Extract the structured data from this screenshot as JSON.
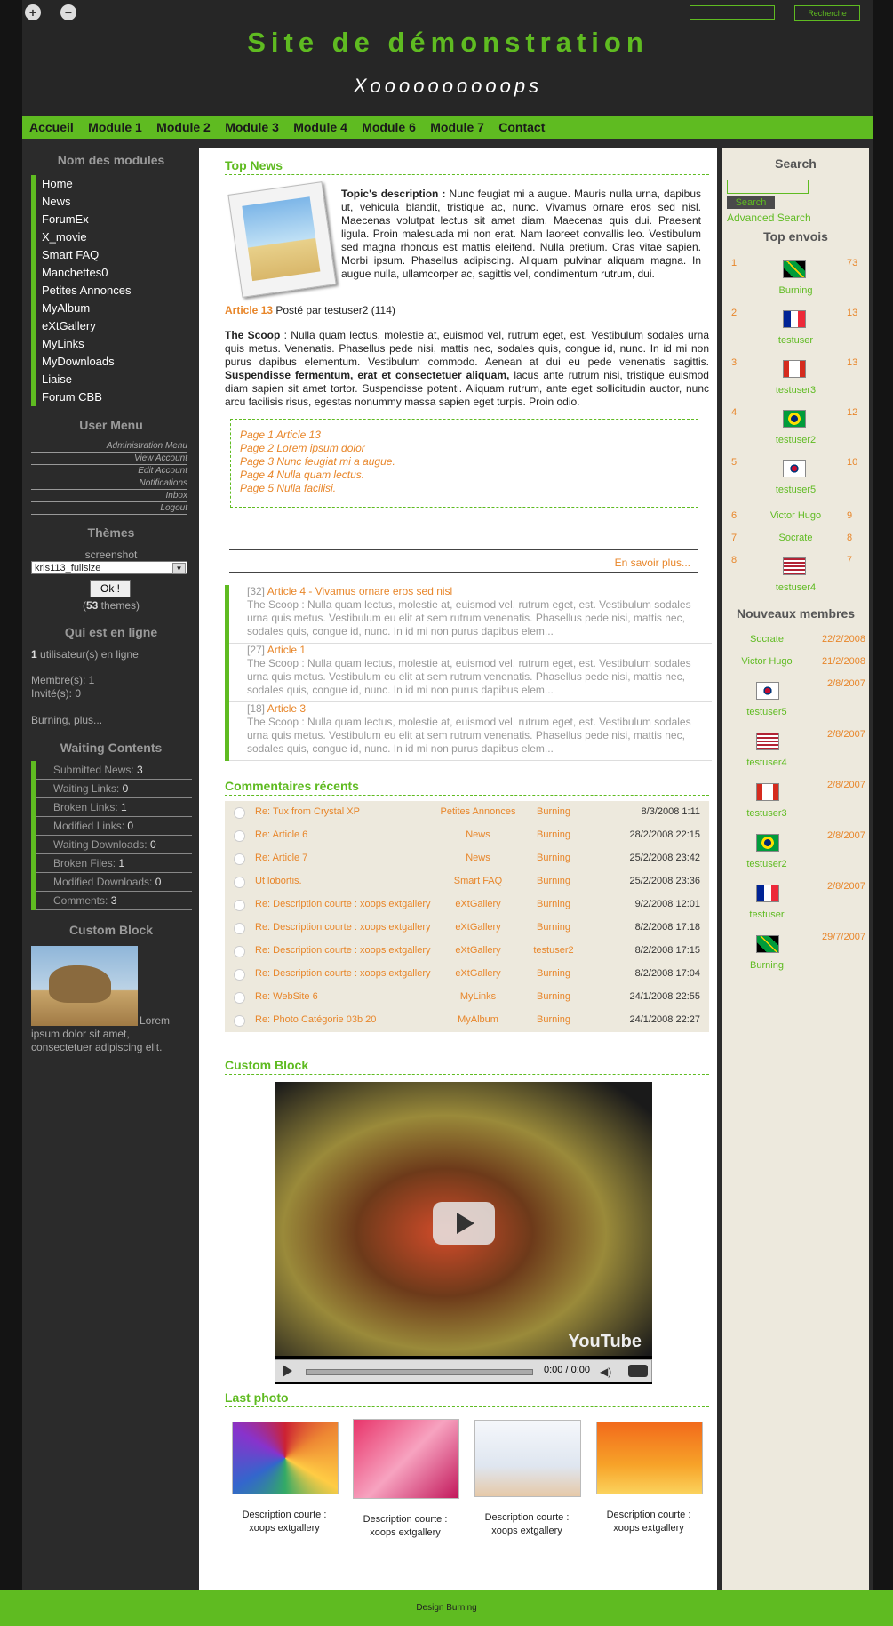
{
  "header": {
    "title": "Site de démonstration",
    "slogan": "Xoooooooooops",
    "search_button": "Recherche"
  },
  "nav": [
    "Accueil",
    "Module 1",
    "Module 2",
    "Module 3",
    "Module 4",
    "Module 6",
    "Module 7",
    "Contact"
  ],
  "left": {
    "modules_title": "Nom des modules",
    "modules": [
      "Home",
      "News",
      "ForumEx",
      "X_movie",
      "Smart FAQ",
      "Manchettes0",
      "Petites Annonces",
      "MyAlbum",
      "eXtGallery",
      "MyLinks",
      "MyDownloads",
      "Liaise",
      "Forum CBB"
    ],
    "user_menu_title": "User Menu",
    "user_menu": [
      "Administration Menu",
      "View Account",
      "Edit Account",
      "Notifications",
      "Inbox",
      "Logout"
    ],
    "themes_title": "Thèmes",
    "themes_label": "screenshot",
    "themes_selected": "kris113_fullsize",
    "themes_button": "Ok !",
    "themes_count": "53",
    "themes_suffix": "themes)",
    "online_title": "Qui est en ligne",
    "online_count": "1",
    "online_text": "utilisateur(s) en ligne",
    "members": "Membre(s): 1",
    "guests": "Invité(s): 0",
    "online_users": "Burning, plus...",
    "waiting_title": "Waiting Contents",
    "waiting": [
      {
        "label": "Submitted News:",
        "value": "3"
      },
      {
        "label": "Waiting Links:",
        "value": "0"
      },
      {
        "label": "Broken Links:",
        "value": "1"
      },
      {
        "label": "Modified Links:",
        "value": "0"
      },
      {
        "label": "Waiting Downloads:",
        "value": "0"
      },
      {
        "label": "Broken Files:",
        "value": "1"
      },
      {
        "label": "Modified Downloads:",
        "value": "0"
      },
      {
        "label": "Comments:",
        "value": "3"
      }
    ],
    "custom_title": "Custom Block",
    "custom_text": "Lorem ipsum dolor sit amet, consectetuer adipiscing elit."
  },
  "main": {
    "top_news_title": "Top News",
    "topic_label": "Topic's description :",
    "topic_text": "Nunc feugiat mi a augue. Mauris nulla urna, dapibus ut, vehicula blandit, tristique ac, nunc. Vivamus ornare eros sed nisl. Maecenas volutpat lectus sit amet diam. Maecenas quis dui. Praesent ligula. Proin malesuada mi non erat. Nam laoreet convallis leo. Vestibulum sed magna rhoncus est mattis eleifend. Nulla pretium. Cras vitae sapien. Morbi ipsum. Phasellus adipiscing. Aliquam pulvinar aliquam magna. In augue nulla, ullamcorper ac, sagittis vel, condimentum rutrum, dui.",
    "article_link": "Article 13",
    "article_meta": "Posté par testuser2 (114)",
    "scoop_label": "The Scoop",
    "scoop_text": ": Nulla quam lectus, molestie at, euismod vel, rutrum eget, est. Vestibulum sodales urna quis metus. Venenatis. Phasellus pede nisi, mattis nec, sodales quis, congue id, nunc. In id mi non purus dapibus elementum. Vestibulum commodo. Aenean at dui eu pede venenatis sagittis.",
    "scoop_bold": "Suspendisse fermentum, erat et consectetuer aliquam,",
    "scoop_text2": "lacus ante rutrum nisi, tristique euismod diam sapien sit amet tortor. Suspendisse potenti. Aliquam rutrum, ante eget sollicitudin auctor, nunc arcu facilisis risus, egestas nonummy massa sapien eget turpis. Proin odio.",
    "pages": [
      "Page 1 Article 13",
      "Page 2 Lorem ipsum dolor",
      "Page 3 Nunc feugiat mi a augue.",
      "Page 4 Nulla quam lectus.",
      "Page 5 Nulla facilisi."
    ],
    "more": "En savoir plus...",
    "related": [
      {
        "id": "[32]",
        "title": "Article 4 - Vivamus ornare eros sed nisl",
        "text": "The Scoop : Nulla quam lectus, molestie at, euismod vel, rutrum eget, est. Vestibulum sodales urna quis metus. Vestibulum eu elit at sem rutrum venenatis. Phasellus pede nisi, mattis nec, sodales quis, congue id, nunc. In id mi non purus dapibus elem..."
      },
      {
        "id": "[27]",
        "title": "Article 1",
        "text": "The Scoop : Nulla quam lectus, molestie at, euismod vel, rutrum eget, est. Vestibulum sodales urna quis metus. Vestibulum eu elit at sem rutrum venenatis. Phasellus pede nisi, mattis nec, sodales quis, congue id, nunc. In id mi non purus dapibus elem..."
      },
      {
        "id": "[18]",
        "title": "Article 3",
        "text": "The Scoop : Nulla quam lectus, molestie at, euismod vel, rutrum eget, est. Vestibulum sodales urna quis metus. Vestibulum eu elit at sem rutrum venenatis. Phasellus pede nisi, mattis nec, sodales quis, congue id, nunc. In id mi non purus dapibus elem..."
      }
    ],
    "comments_title": "Commentaires récents",
    "comments": [
      {
        "title": "Re: Tux from Crystal XP",
        "module": "Petites Annonces",
        "user": "Burning",
        "date": "8/3/2008 1:11"
      },
      {
        "title": "Re: Article 6",
        "module": "News",
        "user": "Burning",
        "date": "28/2/2008 22:15"
      },
      {
        "title": "Re: Article 7",
        "module": "News",
        "user": "Burning",
        "date": "25/2/2008 23:42"
      },
      {
        "title": "Ut lobortis.",
        "module": "Smart FAQ",
        "user": "Burning",
        "date": "25/2/2008 23:36"
      },
      {
        "title": "Re: Description courte : xoops extgallery",
        "module": "eXtGallery",
        "user": "Burning",
        "date": "9/2/2008 12:01"
      },
      {
        "title": "Re: Description courte : xoops extgallery",
        "module": "eXtGallery",
        "user": "Burning",
        "date": "8/2/2008 17:18"
      },
      {
        "title": "Re: Description courte : xoops extgallery",
        "module": "eXtGallery",
        "user": "testuser2",
        "date": "8/2/2008 17:15"
      },
      {
        "title": "Re: Description courte : xoops extgallery",
        "module": "eXtGallery",
        "user": "Burning",
        "date": "8/2/2008 17:04"
      },
      {
        "title": "Re: WebSite 6",
        "module": "MyLinks",
        "user": "Burning",
        "date": "24/1/2008 22:55"
      },
      {
        "title": "Re: Photo Catégorie 03b 20",
        "module": "MyAlbum",
        "user": "Burning",
        "date": "24/1/2008 22:27"
      }
    ],
    "custom_title": "Custom Block",
    "video_time": "0:00 / 0:00",
    "video_brand": "YouTube",
    "last_photo_title": "Last photo",
    "photos": [
      {
        "l1": "Description courte :",
        "l2": "xoops extgallery"
      },
      {
        "l1": "Description courte :",
        "l2": "xoops extgallery"
      },
      {
        "l1": "Description courte :",
        "l2": "xoops extgallery"
      },
      {
        "l1": "Description courte :",
        "l2": "xoops extgallery"
      }
    ]
  },
  "right": {
    "search_title": "Search",
    "search_button": "Search",
    "advanced": "Advanced Search",
    "top_title": "Top envois",
    "top": [
      {
        "rank": "1",
        "name": "Burning",
        "count": "73",
        "flag": "jamaica"
      },
      {
        "rank": "2",
        "name": "testuser",
        "count": "13",
        "flag": "france"
      },
      {
        "rank": "3",
        "name": "testuser3",
        "count": "13",
        "flag": "canada"
      },
      {
        "rank": "4",
        "name": "testuser2",
        "count": "12",
        "flag": "brazil"
      },
      {
        "rank": "5",
        "name": "testuser5",
        "count": "10",
        "flag": "korea"
      },
      {
        "rank": "6",
        "name": "Victor Hugo",
        "count": "9",
        "flag": ""
      },
      {
        "rank": "7",
        "name": "Socrate",
        "count": "8",
        "flag": ""
      },
      {
        "rank": "8",
        "name": "testuser4",
        "count": "7",
        "flag": "usa"
      }
    ],
    "new_title": "Nouveaux membres",
    "new_members": [
      {
        "name": "Socrate",
        "date": "22/2/2008",
        "flag": ""
      },
      {
        "name": "Victor Hugo",
        "date": "21/2/2008",
        "flag": ""
      },
      {
        "name": "testuser5",
        "date": "2/8/2007",
        "flag": "korea"
      },
      {
        "name": "testuser4",
        "date": "2/8/2007",
        "flag": "usa"
      },
      {
        "name": "testuser3",
        "date": "2/8/2007",
        "flag": "canada"
      },
      {
        "name": "testuser2",
        "date": "2/8/2007",
        "flag": "brazil"
      },
      {
        "name": "testuser",
        "date": "2/8/2007",
        "flag": "france"
      },
      {
        "name": "Burning",
        "date": "29/7/2007",
        "flag": "jamaica"
      }
    ]
  },
  "footer": {
    "text": "Design Burning"
  },
  "colors": {
    "accent": "#5fbb21",
    "link": "#e8862a",
    "dark": "#2b2b2b"
  }
}
